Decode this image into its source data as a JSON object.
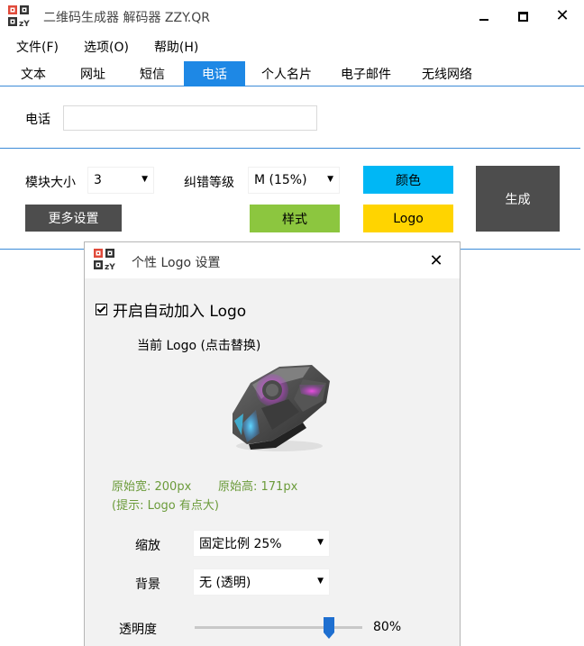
{
  "window": {
    "title": "二维码生成器 解码器 ZZY.QR",
    "close_glyph": "✕"
  },
  "menu": [
    "文件(F)",
    "选项(O)",
    "帮助(H)"
  ],
  "tabs": [
    {
      "label": "文本",
      "active": false
    },
    {
      "label": "网址",
      "active": false
    },
    {
      "label": "短信",
      "active": false
    },
    {
      "label": "电话",
      "active": true
    },
    {
      "label": "个人名片",
      "active": false
    },
    {
      "label": "电子邮件",
      "active": false
    },
    {
      "label": "无线网络",
      "active": false
    }
  ],
  "phone": {
    "label": "电话",
    "value": ""
  },
  "settings": {
    "module_size_label": "模块大小",
    "module_size_value": "3",
    "ecc_label": "纠错等级",
    "ecc_value": "M (15%)",
    "color_button": "颜色",
    "style_button": "样式",
    "logo_button": "Logo",
    "generate_button": "生成",
    "more_settings_button": "更多设置",
    "colors": {
      "color_button": "#00b7f5",
      "style_button": "#8cc63f",
      "logo_button": "#ffd400",
      "dark_button": "#4d4d4d"
    }
  },
  "logo_dialog": {
    "title": "个性 Logo 设置",
    "close_glyph": "✕",
    "auto_add_checked": true,
    "auto_add_label": "开启自动加入 Logo",
    "current_logo_label": "当前 Logo (点击替换)",
    "logo_icon": "gaming-mouse-image",
    "original_width_text": "原始宽: 200px",
    "original_height_text": "原始高: 171px",
    "hint_text": "(提示: Logo 有点大)",
    "info_color": "#6b9b3a",
    "zoom_label": "缩放",
    "zoom_value": "固定比例 25%",
    "background_label": "背景",
    "background_value": "无 (透明)",
    "opacity_label": "透明度",
    "opacity_percent": 80,
    "opacity_text": "80%"
  }
}
